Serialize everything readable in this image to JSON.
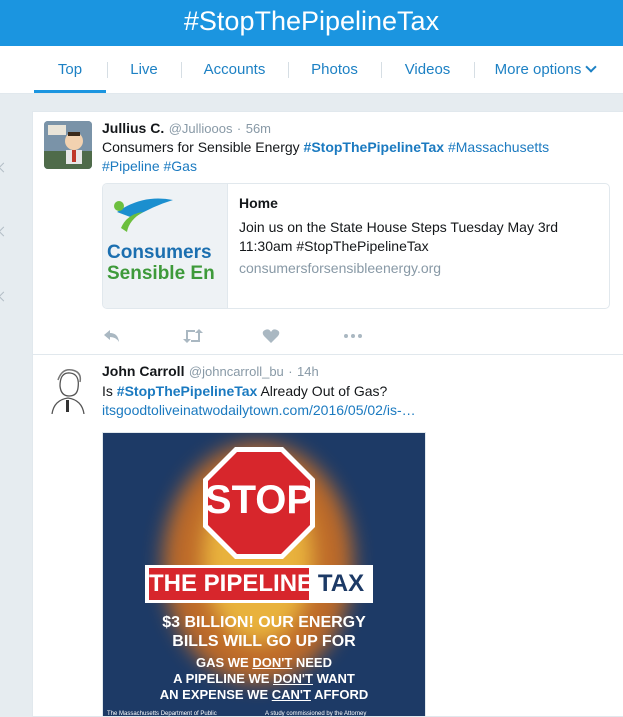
{
  "header": {
    "title": "#StopThePipelineTax"
  },
  "tabs": [
    {
      "label": "Top",
      "active": true
    },
    {
      "label": "Live",
      "active": false
    },
    {
      "label": "Accounts",
      "active": false
    },
    {
      "label": "Photos",
      "active": false
    },
    {
      "label": "Videos",
      "active": false
    },
    {
      "label": "More options",
      "active": false,
      "icon": "chevron-down-icon"
    }
  ],
  "tweets": [
    {
      "name": "Jullius C.",
      "handle": "@Julliooos",
      "sep": "·",
      "time": "56m",
      "text_prefix": "Consumers for Sensible Energy ",
      "hashtags": [
        "#StopThePipelineTax",
        "#Massachusetts",
        "#Pipeline",
        "#Gas"
      ],
      "card": {
        "image_line1": "Consumers",
        "image_line2": "Sensible En",
        "title": "Home",
        "description": "Join us on the State House Steps Tuesday May 3rd 11:30am #StopThePipelineTax",
        "domain": "consumersforsensibleenergy.org"
      },
      "actions": [
        "reply-icon",
        "retweet-icon",
        "like-icon",
        "more-icon"
      ]
    },
    {
      "name": "John Carroll",
      "handle": "@johncarroll_bu",
      "sep": "·",
      "time": "14h",
      "text_prefix": "Is ",
      "hashtag": "#StopThePipelineTax",
      "text_suffix": " Already Out of Gas?",
      "link": "itsgoodtoliveinatwodailytown.com/2016/05/02/is-…",
      "poster": {
        "stop": "STOP",
        "banner_left": "THE PIPELINE",
        "banner_right": "TAX",
        "line1": "$3 BILLION! OUR ENERGY",
        "line2": "BILLS WILL GO UP FOR",
        "line3a": "GAS WE ",
        "line3b": "DON'T",
        "line3c": " NEED",
        "line4a": "A PIPELINE WE ",
        "line4b": "DON'T",
        "line4c": " WANT",
        "line5a": "AN EXPENSE WE ",
        "line5b": "CAN'T",
        "line5c": " AFFORD",
        "foot_left": "The Massachusetts Department of Public",
        "foot_right": "A study commissioned by the Attorney"
      }
    }
  ],
  "colors": {
    "accent": "#1b95e0",
    "link": "#1b7ac0",
    "muted": "#8899a6",
    "stop_red": "#d7262c"
  }
}
